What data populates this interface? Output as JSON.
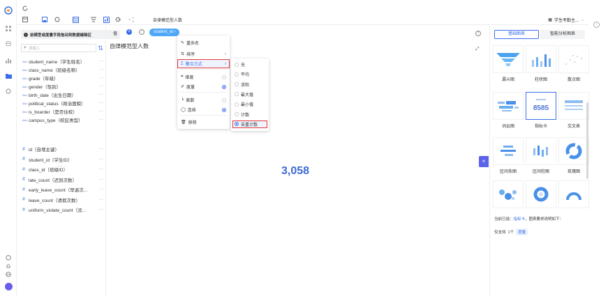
{
  "topbar": {
    "title": "自律模范型人数",
    "user": "学生考勤主..."
  },
  "field_panel": {
    "tip": "前模型或度量字段拖动到数据编辑区",
    "search_placeholder": "请输入",
    "dimensions": [
      {
        "type": "Abc",
        "label": "student_name（学生姓名）"
      },
      {
        "type": "Abc",
        "label": "class_name（班级名称）"
      },
      {
        "type": "Abc",
        "label": "grade（年级）"
      },
      {
        "type": "Abc",
        "label": "gender（性别）"
      },
      {
        "type": "Abc",
        "label": "birth_date（出生日期）"
      },
      {
        "type": "Abc",
        "label": "political_status（政治面貌）"
      },
      {
        "type": "Abc",
        "label": "is_boarder（是否住校）"
      },
      {
        "type": "Abc",
        "label": "campus_type（校区类型）"
      }
    ],
    "measures": [
      {
        "type": "#",
        "label": "id（自增主键）"
      },
      {
        "type": "#",
        "label": "student_id（学生ID）"
      },
      {
        "type": "#",
        "label": "class_id（班级ID）"
      },
      {
        "type": "#",
        "label": "late_count（迟到次数）"
      },
      {
        "type": "#",
        "label": "early_leave_count（早退次..."
      },
      {
        "type": "#",
        "label": "leave_count（请假次数）"
      },
      {
        "type": "#",
        "label": "uniform_violate_count（没..."
      }
    ]
  },
  "canvas": {
    "row_label": "值",
    "chip": "student_id",
    "chart_title": "自律模范型人数",
    "kpi_value": "3,058"
  },
  "context_menu": {
    "items": [
      {
        "icon": "✎",
        "label": "重命名",
        "has_arrow": false
      },
      {
        "icon": "⇅",
        "label": "排序",
        "has_arrow": true
      },
      {
        "icon": "Σ",
        "label": "聚合方式",
        "has_arrow": true
      },
      {
        "icon": "⌗",
        "label": "维度",
        "radio": false
      },
      {
        "icon": "✐",
        "label": "度量",
        "radio": true
      },
      {
        "icon": "╘",
        "label": "离散",
        "radio": false
      },
      {
        "icon": "◯",
        "label": "连续",
        "radio": true
      },
      {
        "icon": "🗑",
        "label": "移除"
      }
    ]
  },
  "aggregation_menu": {
    "options": [
      "无",
      "平均",
      "求和",
      "最大值",
      "最小值",
      "计数",
      "去重计数"
    ],
    "selected": "去重计数"
  },
  "chart_panel": {
    "tab_basic": "基础图表",
    "tab_smart": "智能分析图表",
    "chart_types": [
      {
        "label": "漏斗图",
        "icon": "funnel-icon"
      },
      {
        "label": "柱状图",
        "icon": "bar-chart-icon"
      },
      {
        "label": "散点图",
        "icon": "scatter-icon"
      },
      {
        "label": "词云图",
        "icon": "wordcloud-icon"
      },
      {
        "label": "指标卡",
        "icon": "kpi-card-icon",
        "preview": "8585"
      },
      {
        "label": "交叉表",
        "icon": "crosstab-icon"
      },
      {
        "label": "区间条图",
        "icon": "range-bar-icon"
      },
      {
        "label": "区间柱图",
        "icon": "range-column-icon"
      },
      {
        "label": "玫瑰图",
        "icon": "rose-icon"
      },
      {
        "label": "",
        "icon": "bubble-icon"
      },
      {
        "label": "",
        "icon": "ring-icon"
      },
      {
        "label": "",
        "icon": "gauge-icon"
      }
    ],
    "selected_note_prefix": "当前已选：",
    "selected_note_chart": "指标卡",
    "selected_note_suffix": "，图表要求说明如下：",
    "support_prefix": "仅支持",
    "support_count": "1个",
    "support_tag": "度量"
  },
  "colors": {
    "accent": "#3a6ee8",
    "chip": "#4fa7f7",
    "highlight_border": "#e23a3a",
    "kpi": "#3c6ad6"
  }
}
